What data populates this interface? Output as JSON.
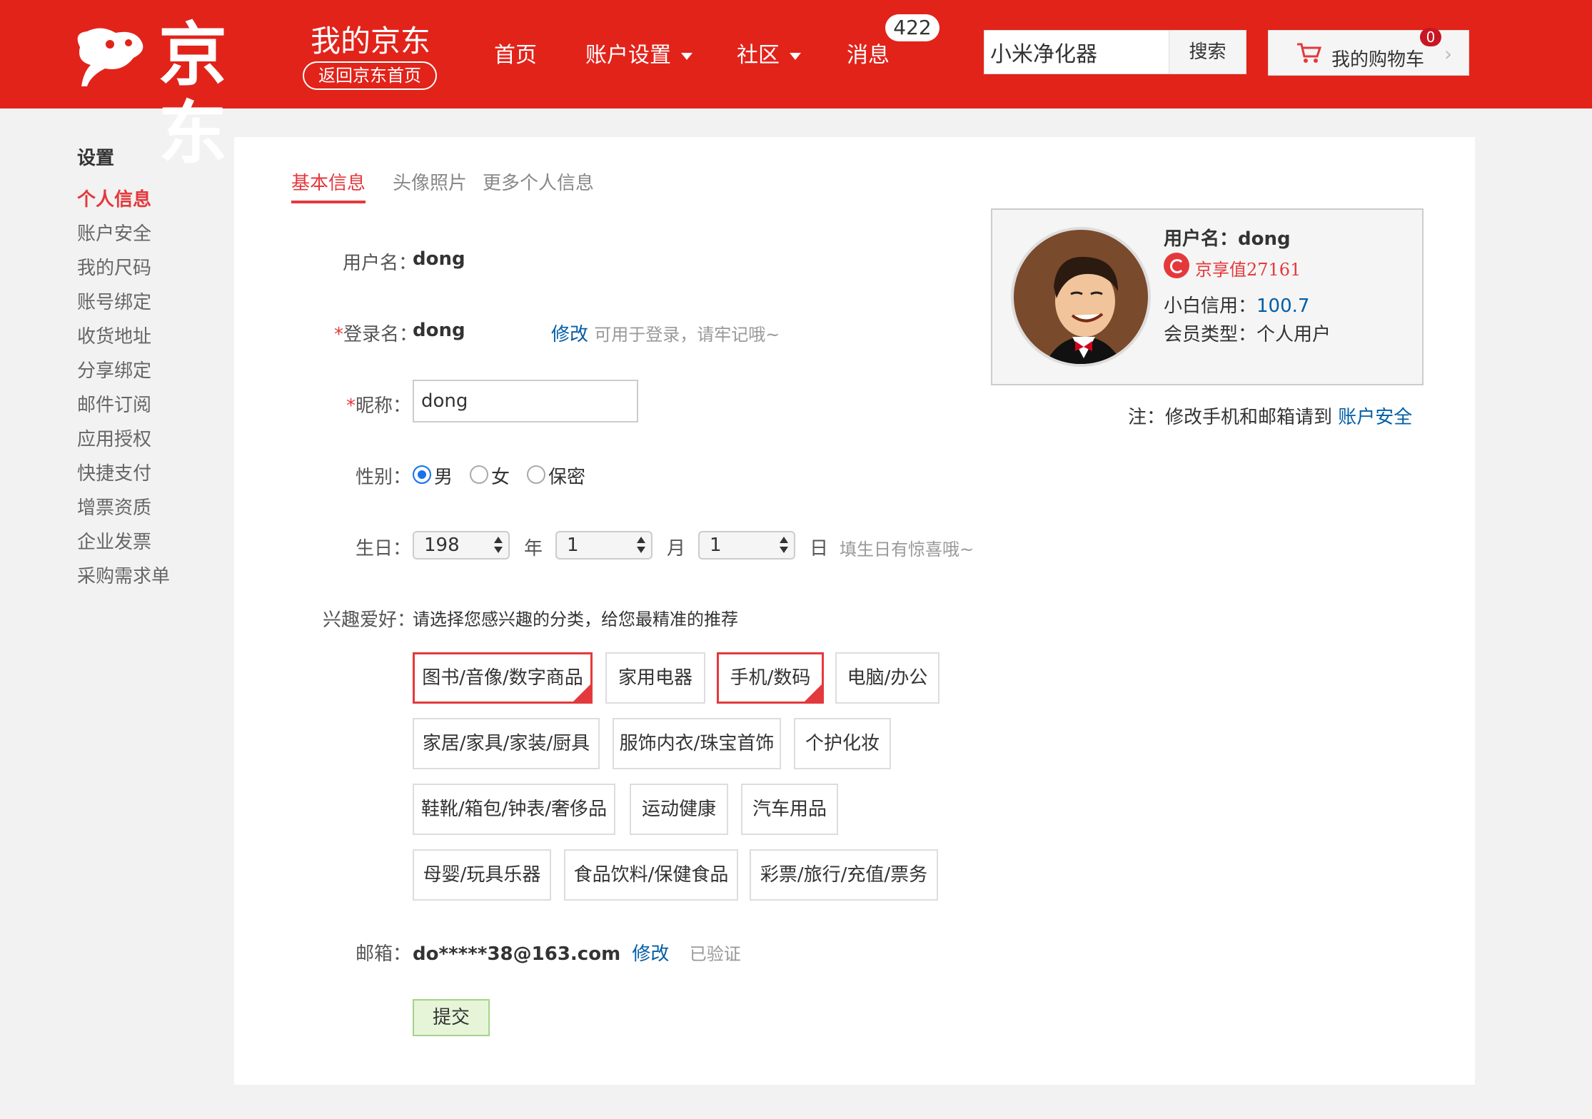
{
  "header": {
    "logo_text": "京东",
    "title": "我的京东",
    "back_home": "返回京东首页",
    "nav": [
      {
        "label": "首页"
      },
      {
        "label": "账户设置"
      },
      {
        "label": "社区"
      },
      {
        "label": "消息"
      }
    ],
    "message_count": "422",
    "search": {
      "value": "小米净化器",
      "button": "搜索"
    },
    "cart": {
      "label": "我的购物车",
      "count": "0",
      "arrow": "›"
    }
  },
  "sidebar": {
    "heading": "设置",
    "items": [
      {
        "label": "个人信息",
        "active": true
      },
      {
        "label": "账户安全"
      },
      {
        "label": "我的尺码"
      },
      {
        "label": "账号绑定"
      },
      {
        "label": "收货地址"
      },
      {
        "label": "分享绑定"
      },
      {
        "label": "邮件订阅"
      },
      {
        "label": "应用授权"
      },
      {
        "label": "快捷支付"
      },
      {
        "label": "增票资质"
      },
      {
        "label": "企业发票"
      },
      {
        "label": "采购需求单"
      }
    ]
  },
  "tabs": [
    {
      "label": "基本信息",
      "active": true
    },
    {
      "label": "头像照片"
    },
    {
      "label": "更多个人信息"
    }
  ],
  "form": {
    "username_label": "用户名：",
    "username": "dong",
    "login_required": "*",
    "login_label": "登录名：",
    "login": "dong",
    "login_modify": "修改",
    "login_hint": "可用于登录，请牢记哦~",
    "nick_required": "*",
    "nick_label": "昵称：",
    "nick_value": "dong",
    "gender_label": "性别：",
    "gender_options": [
      "男",
      "女",
      "保密"
    ],
    "gender_selected": "男",
    "birthday_label": "生日：",
    "birth_year": "198",
    "birth_month": "1",
    "birth_day": "1",
    "year_unit": "年",
    "month_unit": "月",
    "day_unit": "日",
    "birthday_hint": "填生日有惊喜哦~",
    "interest_label": "兴趣爱好：",
    "interest_hint": "请选择您感兴趣的分类，给您最精准的推荐",
    "interests": [
      {
        "label": "图书/音像/数字商品",
        "selected": true
      },
      {
        "label": "家用电器",
        "selected": false
      },
      {
        "label": "手机/数码",
        "selected": true
      },
      {
        "label": "电脑/办公",
        "selected": false
      },
      {
        "label": "家居/家具/家装/厨具",
        "selected": false
      },
      {
        "label": "服饰内衣/珠宝首饰",
        "selected": false
      },
      {
        "label": "个护化妆",
        "selected": false
      },
      {
        "label": "鞋靴/箱包/钟表/奢侈品",
        "selected": false
      },
      {
        "label": "运动健康",
        "selected": false
      },
      {
        "label": "汽车用品",
        "selected": false
      },
      {
        "label": "母婴/玩具乐器",
        "selected": false
      },
      {
        "label": "食品饮料/保健食品",
        "selected": false
      },
      {
        "label": "彩票/旅行/充值/票务",
        "selected": false
      }
    ],
    "email_label": "邮箱：",
    "email": "do*****38@163.com",
    "email_modify": "修改",
    "email_status": "已验证",
    "submit": "提交"
  },
  "profile": {
    "username_label": "用户名：",
    "username": "dong",
    "jd_value": "京享值27161",
    "credit_label": "小白信用：",
    "credit_value": "100.7",
    "member_type": "会员类型：个人用户"
  },
  "note": {
    "text": "注：修改手机和邮箱请到",
    "link": "账户安全"
  },
  "colors": {
    "brand_red": "#e2231a",
    "accent_red": "#e4393c",
    "link_blue": "#005ea7"
  }
}
